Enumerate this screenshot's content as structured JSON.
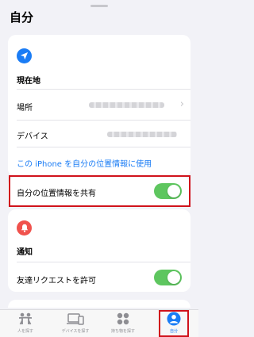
{
  "header": {
    "title": "自分"
  },
  "location_card": {
    "section_title": "現在地",
    "place_label": "場所",
    "device_label": "デバイス",
    "use_iphone_link": "この iPhone を自分の位置情報に使用"
  },
  "share_card": {
    "label": "自分の位置情報を共有",
    "enabled": true
  },
  "notify_card": {
    "section_title": "通知",
    "friend_request_label": "友達リクエストを許可",
    "friend_request_enabled": true
  },
  "tabbar": {
    "people": "人を探す",
    "devices": "デバイスを探す",
    "items": "持ち物を探す",
    "me": "自分"
  },
  "colors": {
    "accent": "#1a7cf5",
    "toggle_on": "#5ec65f",
    "notification": "#f0524d",
    "highlight": "#d0121b"
  }
}
